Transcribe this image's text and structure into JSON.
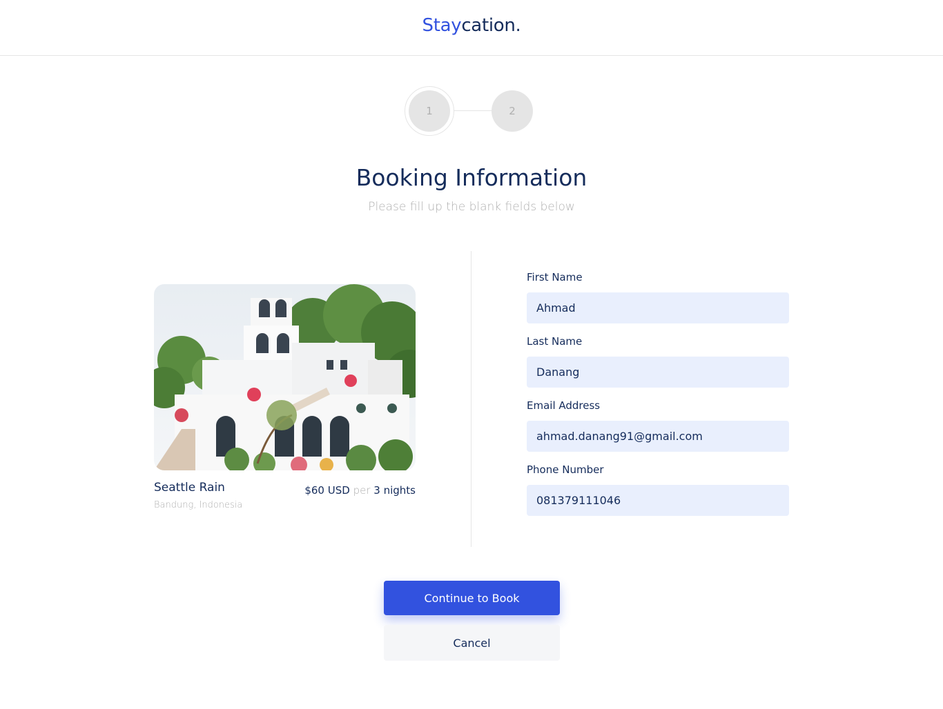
{
  "brand": {
    "part1": "Stay",
    "part2": "cation."
  },
  "stepper": {
    "steps": [
      "1",
      "2"
    ],
    "current": 1
  },
  "header": {
    "title": "Booking Information",
    "subtitle": "Please fill up the blank fields below"
  },
  "property": {
    "image_icon": "villa-photo",
    "name": "Seattle Rain",
    "location": "Bandung, Indonesia",
    "price": "$60 USD",
    "per_label": "per",
    "duration": "3 nights"
  },
  "form": {
    "first_name": {
      "label": "First Name",
      "value": "Ahmad"
    },
    "last_name": {
      "label": "Last Name",
      "value": "Danang"
    },
    "email": {
      "label": "Email Address",
      "value": "ahmad.danang91@gmail.com"
    },
    "phone": {
      "label": "Phone Number",
      "value": "081379111046"
    }
  },
  "actions": {
    "continue_label": "Continue to Book",
    "cancel_label": "Cancel"
  },
  "colors": {
    "accent": "#3252df",
    "heading": "#152c5b",
    "muted": "#b0b0b0",
    "input_bg": "#e9effd"
  }
}
